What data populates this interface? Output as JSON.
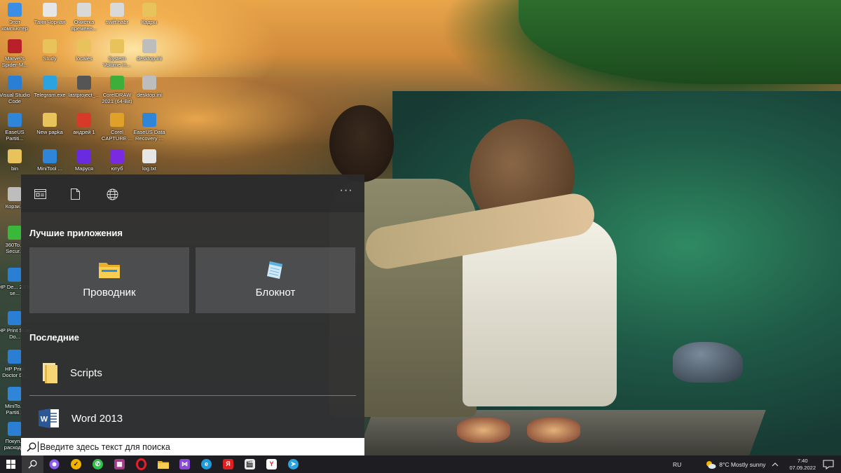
{
  "desktop": {
    "icons": [
      {
        "label": "Этот компьютер",
        "icon": "computer-icon",
        "color": "#3a8ee6"
      },
      {
        "label": "Таня Чорная",
        "icon": "document-icon",
        "color": "#e6e6e6"
      },
      {
        "label": "Очистка временн...",
        "icon": "cleaner-icon",
        "color": "#d9d9d9"
      },
      {
        "label": "swift.habr",
        "icon": "file-icon",
        "color": "#d9d9d9"
      },
      {
        "label": "Кадры",
        "icon": "folder-icon",
        "color": "#e8c25a"
      },
      {
        "label": "Marvel's Spider-M...",
        "icon": "spider-icon",
        "color": "#b8202a"
      },
      {
        "label": "Study",
        "icon": "folder-icon",
        "color": "#e8c25a"
      },
      {
        "label": "locales",
        "icon": "folder-icon",
        "color": "#e8c25a"
      },
      {
        "label": "System Volume In...",
        "icon": "folder-icon",
        "color": "#e8c25a"
      },
      {
        "label": "desktop.ini",
        "icon": "ini-file-icon",
        "color": "#bdbdbd"
      },
      {
        "label": "Visual Studio Code",
        "icon": "vscode-icon",
        "color": "#2a7fd4"
      },
      {
        "label": "Telegram.exe",
        "icon": "telegram-icon",
        "color": "#2aa3e0"
      },
      {
        "label": "lastproject_...",
        "icon": "image-file-icon",
        "color": "#555555"
      },
      {
        "label": "CorelDRAW 2021 (64-Bit)",
        "icon": "coreldraw-icon",
        "color": "#3dae3a"
      },
      {
        "label": "desktop.ini",
        "icon": "ini-file-icon",
        "color": "#bdbdbd"
      },
      {
        "label": "EaseUS Partiti...",
        "icon": "easeus-icon",
        "color": "#2f86d8"
      },
      {
        "label": "New papka",
        "icon": "folder-icon",
        "color": "#e8c25a"
      },
      {
        "label": "андрей 1",
        "icon": "pdf-icon",
        "color": "#d83a2a"
      },
      {
        "label": "Corel CAPTURE ...",
        "icon": "corel-capture-icon",
        "color": "#e0a12a"
      },
      {
        "label": "EaseUS Data Recovery ...",
        "icon": "easeus-recovery-icon",
        "color": "#2f86d8"
      },
      {
        "label": "bin",
        "icon": "folder-icon",
        "color": "#e8c25a"
      },
      {
        "label": "MiniTool ...",
        "icon": "minitool-icon",
        "color": "#2f86d8"
      },
      {
        "label": "Маруся",
        "icon": "marusya-icon",
        "color": "#6a2ae0"
      },
      {
        "label": "ютуб",
        "icon": "video-file-icon",
        "color": "#7a2ae0"
      },
      {
        "label": "log.txt",
        "icon": "text-file-icon",
        "color": "#e6e6e6"
      },
      {
        "label": "Корзи...",
        "icon": "recycle-bin-icon",
        "color": "#bdbdbd"
      },
      {
        "label": "360To... Secur...",
        "icon": "360-security-icon",
        "color": "#3ab83a"
      },
      {
        "label": "HP De... 2300 se...",
        "icon": "hp-icon",
        "color": "#2a7fd4"
      },
      {
        "label": "HP Print Scan Do...",
        "icon": "hp-scan-icon",
        "color": "#2a7fd4"
      },
      {
        "label": "HP Print Doctor D...",
        "icon": "hp-doctor-icon",
        "color": "#2a7fd4"
      },
      {
        "label": "MiniTo... Partiti...",
        "icon": "minitool-partition-icon",
        "color": "#2f86d8"
      },
      {
        "label": "Покуп... расход...",
        "icon": "shopping-icon",
        "color": "#2a7fd4"
      }
    ]
  },
  "search_panel": {
    "header_buttons": [
      {
        "name": "apps-filter-icon"
      },
      {
        "name": "documents-filter-icon"
      },
      {
        "name": "web-filter-icon"
      }
    ],
    "more_label": "···",
    "top_apps_title": "Лучшие приложения",
    "top_apps": [
      {
        "label": "Проводник",
        "icon": "file-explorer-icon"
      },
      {
        "label": "Блокнот",
        "icon": "notepad-icon"
      }
    ],
    "recent_title": "Последние",
    "recent": [
      {
        "label": "Scripts",
        "icon": "folder-icon"
      },
      {
        "label": "Word 2013",
        "icon": "word-icon"
      }
    ]
  },
  "search_box": {
    "placeholder": "Введите здесь текст для поиска"
  },
  "taskbar": {
    "buttons": [
      {
        "name": "start-button",
        "icon": "windows-logo-icon",
        "color": "#ffffff",
        "glyph": ""
      },
      {
        "name": "search-taskbar-button",
        "icon": "search-icon",
        "color": "#ffffff",
        "glyph": ""
      },
      {
        "name": "alice-button",
        "icon": "alice-icon",
        "color": "#8a5cf0",
        "glyph": ""
      },
      {
        "name": "norton-button",
        "icon": "norton-icon",
        "color": "#f0b400",
        "glyph": "✓"
      },
      {
        "name": "whatsapp-button",
        "icon": "whatsapp-icon",
        "color": "#2ec24a",
        "glyph": "✆"
      },
      {
        "name": "winrar-button",
        "icon": "winrar-icon",
        "color": "#a33a8a",
        "glyph": "▦"
      },
      {
        "name": "opera-button",
        "icon": "opera-icon",
        "color": "#e0202a",
        "glyph": "O"
      },
      {
        "name": "file-explorer-button",
        "icon": "file-explorer-icon",
        "color": "#e8c25a",
        "glyph": ""
      },
      {
        "name": "vs-button",
        "icon": "visual-studio-icon",
        "color": "#8a4ad8",
        "glyph": "⋈"
      },
      {
        "name": "edge-button",
        "icon": "edge-icon",
        "color": "#1e9be0",
        "glyph": "e"
      },
      {
        "name": "yandex-button",
        "icon": "yandex-icon",
        "color": "#e02020",
        "glyph": "Я"
      },
      {
        "name": "video-editor-button",
        "icon": "clapperboard-icon",
        "color": "#e8e8e8",
        "glyph": "🎬"
      },
      {
        "name": "yandex-browser-button",
        "icon": "yandex-browser-icon",
        "color": "#ffffff",
        "glyph": "Y"
      },
      {
        "name": "telegram-button",
        "icon": "telegram-icon",
        "color": "#2aa3e0",
        "glyph": "➤"
      }
    ],
    "language": "RU",
    "weather": "8°C  Mostly sunny",
    "time": "7:40",
    "date": "07.09.2022",
    "notification_icon": "notification-icon"
  }
}
